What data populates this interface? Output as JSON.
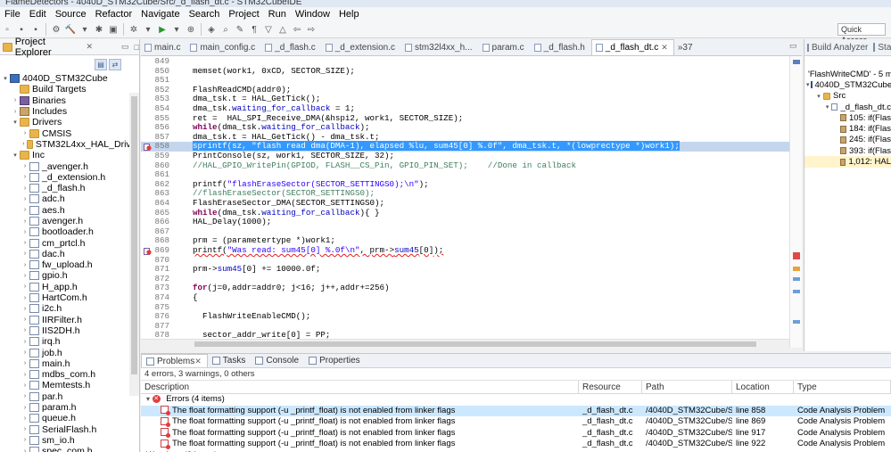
{
  "window": {
    "title": "FlameDetectors - 4040D_STM32Cube/Src/_d_flash_dt.c - STM32CubeIDE"
  },
  "menu": [
    "File",
    "Edit",
    "Source",
    "Refactor",
    "Navigate",
    "Search",
    "Project",
    "Run",
    "Window",
    "Help"
  ],
  "toolbar": {
    "quick_access": "Quick Access"
  },
  "project_explorer": {
    "title": "Project Explorer",
    "items": [
      {
        "label": "4040D_STM32Cube",
        "indent": 0,
        "arrow": "▾",
        "icon": "proj"
      },
      {
        "label": "Build Targets",
        "indent": 1,
        "arrow": "",
        "icon": "folder"
      },
      {
        "label": "Binaries",
        "indent": 1,
        "arrow": "›",
        "icon": "bin"
      },
      {
        "label": "Includes",
        "indent": 1,
        "arrow": "›",
        "icon": "inc"
      },
      {
        "label": "Drivers",
        "indent": 1,
        "arrow": "▾",
        "icon": "folder"
      },
      {
        "label": "CMSIS",
        "indent": 2,
        "arrow": "›",
        "icon": "folder"
      },
      {
        "label": "STM32L4xx_HAL_Driver",
        "indent": 2,
        "arrow": "›",
        "icon": "folder"
      },
      {
        "label": "Inc",
        "indent": 1,
        "arrow": "▾",
        "icon": "folder"
      },
      {
        "label": "_avenger.h",
        "indent": 2,
        "arrow": "›",
        "icon": "file"
      },
      {
        "label": "_d_extension.h",
        "indent": 2,
        "arrow": "›",
        "icon": "file"
      },
      {
        "label": "_d_flash.h",
        "indent": 2,
        "arrow": "›",
        "icon": "file"
      },
      {
        "label": "adc.h",
        "indent": 2,
        "arrow": "›",
        "icon": "file"
      },
      {
        "label": "aes.h",
        "indent": 2,
        "arrow": "›",
        "icon": "file"
      },
      {
        "label": "avenger.h",
        "indent": 2,
        "arrow": "›",
        "icon": "file"
      },
      {
        "label": "bootloader.h",
        "indent": 2,
        "arrow": "›",
        "icon": "file"
      },
      {
        "label": "cm_prtcl.h",
        "indent": 2,
        "arrow": "›",
        "icon": "file"
      },
      {
        "label": "dac.h",
        "indent": 2,
        "arrow": "›",
        "icon": "file"
      },
      {
        "label": "fw_upload.h",
        "indent": 2,
        "arrow": "›",
        "icon": "file"
      },
      {
        "label": "gpio.h",
        "indent": 2,
        "arrow": "›",
        "icon": "file"
      },
      {
        "label": "H_app.h",
        "indent": 2,
        "arrow": "›",
        "icon": "file"
      },
      {
        "label": "HartCom.h",
        "indent": 2,
        "arrow": "›",
        "icon": "file"
      },
      {
        "label": "i2c.h",
        "indent": 2,
        "arrow": "›",
        "icon": "file"
      },
      {
        "label": "IIRFilter.h",
        "indent": 2,
        "arrow": "›",
        "icon": "file"
      },
      {
        "label": "IIS2DH.h",
        "indent": 2,
        "arrow": "›",
        "icon": "file"
      },
      {
        "label": "irq.h",
        "indent": 2,
        "arrow": "›",
        "icon": "file"
      },
      {
        "label": "job.h",
        "indent": 2,
        "arrow": "›",
        "icon": "file"
      },
      {
        "label": "main.h",
        "indent": 2,
        "arrow": "›",
        "icon": "file"
      },
      {
        "label": "mdbs_com.h",
        "indent": 2,
        "arrow": "›",
        "icon": "file"
      },
      {
        "label": "Memtests.h",
        "indent": 2,
        "arrow": "›",
        "icon": "file"
      },
      {
        "label": "par.h",
        "indent": 2,
        "arrow": "›",
        "icon": "file"
      },
      {
        "label": "param.h",
        "indent": 2,
        "arrow": "›",
        "icon": "file"
      },
      {
        "label": "queue.h",
        "indent": 2,
        "arrow": "›",
        "icon": "file"
      },
      {
        "label": "SerialFlash.h",
        "indent": 2,
        "arrow": "›",
        "icon": "file"
      },
      {
        "label": "sm_io.h",
        "indent": 2,
        "arrow": "›",
        "icon": "file"
      },
      {
        "label": "spec_com.h",
        "indent": 2,
        "arrow": "›",
        "icon": "file"
      }
    ]
  },
  "editor_tabs": [
    {
      "label": "main.c",
      "active": false
    },
    {
      "label": "main_config.c",
      "active": false
    },
    {
      "label": "_d_flash.c",
      "active": false
    },
    {
      "label": "_d_extension.c",
      "active": false
    },
    {
      "label": "stm32l4xx_h...",
      "active": false
    },
    {
      "label": "param.c",
      "active": false
    },
    {
      "label": "_d_flash.h",
      "active": false
    },
    {
      "label": "_d_flash_dt.c",
      "active": true
    },
    {
      "label": "»37",
      "active": false
    }
  ],
  "code_lines": [
    {
      "n": "849",
      "html": ""
    },
    {
      "n": "850",
      "html": "memset(work1, 0xCD, SECTOR_SIZE);"
    },
    {
      "n": "851",
      "html": ""
    },
    {
      "n": "852",
      "html": "FlashReadCMD(addr0);"
    },
    {
      "n": "853",
      "html": "dma_tsk.t = HAL_GetTick();"
    },
    {
      "n": "854",
      "html": "dma_tsk.waiting_for_callback = 1;"
    },
    {
      "n": "855",
      "html": "ret =  HAL_SPI_Receive_DMA(&hspi2, work1, SECTOR_SIZE);"
    },
    {
      "n": "856",
      "html": "while(dma_tsk.waiting_for_callback);"
    },
    {
      "n": "857",
      "html": "dma_tsk.t = HAL_GetTick() - dma_tsk.t;"
    },
    {
      "n": "858",
      "html": "sprintf(sz, \"flash read dma(DMA-1), elapsed %lu, sum45[0] %.0f\", dma_tsk.t, *(lowprectype *)work1);"
    },
    {
      "n": "859",
      "html": "PrintConsole(sz, work1, SECTOR_SIZE, 32);"
    },
    {
      "n": "860",
      "html": "//HAL_GPIO_WritePin(GPIOD, FLASH__CS_Pin, GPIO_PIN_SET);    //Done in callback"
    },
    {
      "n": "861",
      "html": ""
    },
    {
      "n": "862",
      "html": "printf(\"flashEraseSector(SECTOR_SETTINGS0);\\n\");"
    },
    {
      "n": "863",
      "html": "//flashEraseSector(SECTOR_SETTINGS0);"
    },
    {
      "n": "864",
      "html": "FlashEraseSector_DMA(SECTOR_SETTINGS0);"
    },
    {
      "n": "865",
      "html": "while(dma_tsk.waiting_for_callback){ }"
    },
    {
      "n": "866",
      "html": "HAL_Delay(1000);"
    },
    {
      "n": "867",
      "html": ""
    },
    {
      "n": "868",
      "html": "prm = (parametertype *)work1;"
    },
    {
      "n": "869",
      "html": "printf(\"Was read: sum45[0] %.0f\\n\", prm->sum45[0]);"
    },
    {
      "n": "870",
      "html": ""
    },
    {
      "n": "871",
      "html": "prm->sum45[0] += 10000.0f;"
    },
    {
      "n": "872",
      "html": ""
    },
    {
      "n": "873",
      "html": "for(j=0,addr=addr0; j<16; j++,addr+=256)"
    },
    {
      "n": "874",
      "html": "{"
    },
    {
      "n": "875",
      "html": ""
    },
    {
      "n": "876",
      "html": "  FlashWriteEnableCMD();"
    },
    {
      "n": "877",
      "html": ""
    },
    {
      "n": "878",
      "html": "  sector_addr_write[0] = PP;"
    },
    {
      "n": "879",
      "html": "  sector_addr_write[1] = (addr >> 16) & 0xff;"
    }
  ],
  "right_panel": {
    "tabs": [
      "Build Analyzer",
      "Sta"
    ],
    "title": "'FlashWriteCMD' - 5 matc",
    "rows": [
      {
        "label": "4040D_STM32Cube",
        "indent": 0,
        "arrow": "▾"
      },
      {
        "label": "Src",
        "indent": 1,
        "arrow": "▾"
      },
      {
        "label": "_d_flash_dt.c",
        "indent": 2,
        "arrow": "▾"
      },
      {
        "label": "105: if(Flas",
        "indent": 3,
        "arrow": ""
      },
      {
        "label": "184: if(Flas",
        "indent": 3,
        "arrow": ""
      },
      {
        "label": "245: if(Flas",
        "indent": 3,
        "arrow": ""
      },
      {
        "label": "393: if(Flas",
        "indent": 3,
        "arrow": ""
      },
      {
        "label": "1,012: HAL",
        "indent": 3,
        "arrow": ""
      }
    ]
  },
  "bottom_panel": {
    "tabs": [
      "Problems",
      "Tasks",
      "Console",
      "Properties"
    ],
    "summary": "4 errors, 3 warnings, 0 others",
    "columns": [
      "Description",
      "Resource",
      "Path",
      "Location",
      "Type"
    ],
    "group": "Errors (4 items)",
    "rows": [
      {
        "desc": "The float formatting support (-u _printf_float) is not enabled from linker flags",
        "resource": "_d_flash_dt.c",
        "path": "/4040D_STM32Cube/Src",
        "location": "line 858",
        "type": "Code Analysis Problem"
      },
      {
        "desc": "The float formatting support (-u _printf_float) is not enabled from linker flags",
        "resource": "_d_flash_dt.c",
        "path": "/4040D_STM32Cube/Src",
        "location": "line 869",
        "type": "Code Analysis Problem"
      },
      {
        "desc": "The float formatting support (-u _printf_float) is not enabled from linker flags",
        "resource": "_d_flash_dt.c",
        "path": "/4040D_STM32Cube/Src",
        "location": "line 917",
        "type": "Code Analysis Problem"
      },
      {
        "desc": "The float formatting support (-u _printf_float) is not enabled from linker flags",
        "resource": "_d_flash_dt.c",
        "path": "/4040D_STM32Cube/Src",
        "location": "line 922",
        "type": "Code Analysis Problem"
      }
    ],
    "warnings_partial": "Warnings (3 items)"
  }
}
